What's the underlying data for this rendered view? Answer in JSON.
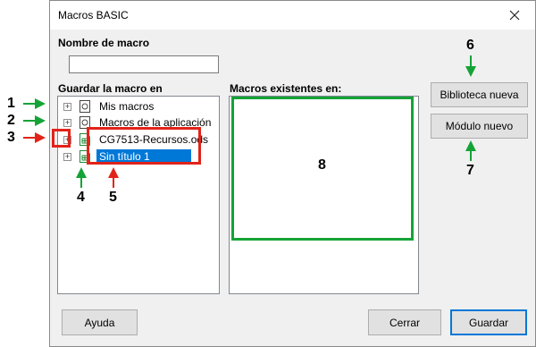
{
  "window": {
    "title": "Macros BASIC"
  },
  "macro_name": {
    "label": "Nombre de macro",
    "value": ""
  },
  "save_in": {
    "label": "Guardar la macro en",
    "items": [
      {
        "label": "Mis macros",
        "icon": "macro-library-icon",
        "selected": false
      },
      {
        "label": "Macros de la aplicación",
        "icon": "macro-library-icon",
        "selected": false
      },
      {
        "label": "CG7513-Recursos.ods",
        "icon": "spreadsheet-doc-icon",
        "selected": false
      },
      {
        "label": "Sin título 1",
        "icon": "spreadsheet-doc-icon",
        "selected": true
      }
    ]
  },
  "existing": {
    "label": "Macros existentes en:"
  },
  "buttons": {
    "new_library": "Biblioteca nueva",
    "new_module": "Módulo nuevo",
    "help": "Ayuda",
    "close": "Cerrar",
    "save": "Guardar"
  },
  "annotations": {
    "numbers": [
      "1",
      "2",
      "3",
      "4",
      "5",
      "6",
      "7",
      "8"
    ],
    "colors": {
      "green": "#14a337",
      "red": "#e2231a"
    }
  }
}
